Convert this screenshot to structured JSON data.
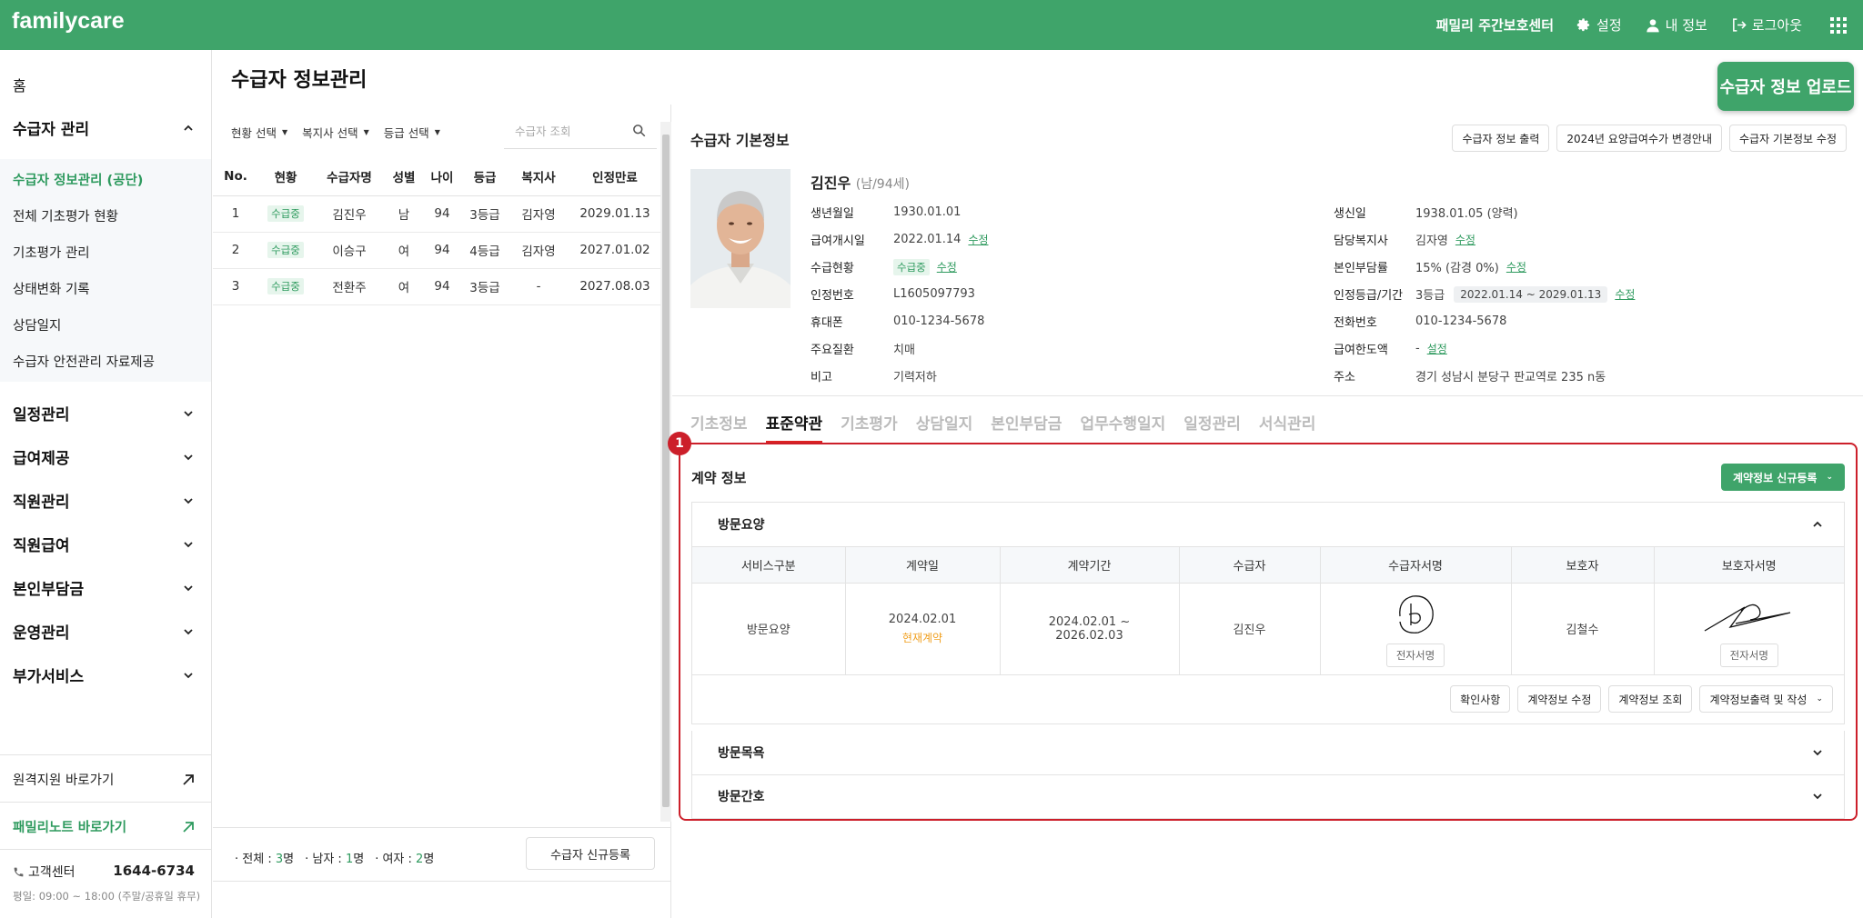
{
  "header": {
    "logo": "familycare",
    "center_name": "패밀리 주간보호센터",
    "settings": "설정",
    "my_info": "내 정보",
    "logout": "로그아웃"
  },
  "sidebar": {
    "home": "홈",
    "group_recipient": "수급자 관리",
    "sub_items": [
      "수급자 정보관리 (공단)",
      "전체 기초평가 현황",
      "기초평가 관리",
      "상태변화 기록",
      "상담일지",
      "수급자 안전관리 자료제공"
    ],
    "groups": [
      "일정관리",
      "급여제공",
      "직원관리",
      "직원급여",
      "본인부담금",
      "운영관리",
      "부가서비스"
    ],
    "remote_link": "원격지원 바로가기",
    "familynote_link": "패밀리노트 바로가기",
    "cs_label": "고객센터",
    "cs_phone": "1644-6734",
    "cs_hours": "평일: 09:00 ~ 18:00 (주말/공휴일 휴무)"
  },
  "page": {
    "title": "수급자 정보관리",
    "upload_button": "수급자 정보 업로드"
  },
  "list": {
    "filter_status": "현황 선택",
    "filter_worker": "복지사 선택",
    "filter_grade": "등급 선택",
    "search_placeholder": "수급자 조회",
    "headers": [
      "No.",
      "현황",
      "수급자명",
      "성별",
      "나이",
      "등급",
      "복지사",
      "인정만료"
    ],
    "rows": [
      {
        "no": "1",
        "status": "수급중",
        "name": "김진우",
        "gender": "남",
        "age": "94",
        "grade": "3등급",
        "worker": "김자영",
        "expire": "2029.01.13"
      },
      {
        "no": "2",
        "status": "수급중",
        "name": "이승구",
        "gender": "여",
        "age": "94",
        "grade": "4등급",
        "worker": "김자영",
        "expire": "2027.01.02"
      },
      {
        "no": "3",
        "status": "수급중",
        "name": "전환주",
        "gender": "여",
        "age": "94",
        "grade": "3등급",
        "worker": "-",
        "expire": "2027.08.03"
      }
    ],
    "total_label": "전체 : ",
    "total_value": "3",
    "male_label": "남자 : ",
    "male_value": "1",
    "female_label": "여자 : ",
    "female_value": "2",
    "unit": "명",
    "new_button": "수급자 신규등록"
  },
  "detail": {
    "section_title": "수급자 기본정보",
    "btn_print": "수급자 정보 출력",
    "btn_notice": "2024년 요양급여수가 변경안내",
    "btn_edit": "수급자 기본정보 수정",
    "name": "김진우",
    "name_meta": "(남/94세)",
    "edit_label": "수정",
    "set_label": "설정",
    "left": [
      {
        "label": "생년월일",
        "value": "1930.01.01"
      },
      {
        "label": "급여개시일",
        "value": "2022.01.14"
      },
      {
        "label": "수급현황",
        "value": "수급중"
      },
      {
        "label": "인정번호",
        "value": "L1605097793"
      },
      {
        "label": "휴대폰",
        "value": "010-1234-5678"
      },
      {
        "label": "주요질환",
        "value": "치매"
      },
      {
        "label": "비고",
        "value": "기력저하"
      }
    ],
    "right": [
      {
        "label": "생신일",
        "value": "1938.01.05 (양력)"
      },
      {
        "label": "담당복지사",
        "value": "김자영"
      },
      {
        "label": "본인부담률",
        "value": "15% (감경 0%)"
      },
      {
        "label": "인정등급/기간",
        "value": "3등급",
        "badge": "2022.01.14 ~ 2029.01.13"
      },
      {
        "label": "전화번호",
        "value": "010-1234-5678"
      },
      {
        "label": "급여한도액",
        "value": "-"
      },
      {
        "label": "주소",
        "value": "경기 성남시 분당구 판교역로 235 n동"
      }
    ],
    "tabs": [
      "기초정보",
      "표준약관",
      "기초평가",
      "상담일지",
      "본인부담금",
      "업무수행일지",
      "일정관리",
      "서식관리"
    ],
    "active_tab": 1
  },
  "contract": {
    "marker": "1",
    "title": "계약 정보",
    "register_button": "계약정보 신규등록",
    "sections": [
      "방문요양",
      "방문목욕",
      "방문간호"
    ],
    "headers": [
      "서비스구분",
      "계약일",
      "계약기간",
      "수급자",
      "수급자서명",
      "보호자",
      "보호자서명"
    ],
    "row": {
      "service": "방문요양",
      "date": "2024.02.01",
      "current": "현재계약",
      "period": "2024.02.01 ~\n2026.02.03",
      "recipient": "김진우",
      "guardian": "김철수",
      "esign": "전자서명"
    },
    "btn_confirm": "확인사항",
    "btn_edit": "계약정보 수정",
    "btn_view": "계약정보 조회",
    "btn_print": "계약정보출력 및 작성"
  },
  "colors": {
    "brand": "#3fa46a",
    "highlight": "#cc1f2a",
    "accent_text": "#2e9a5e",
    "current_contract": "#f0a020"
  }
}
